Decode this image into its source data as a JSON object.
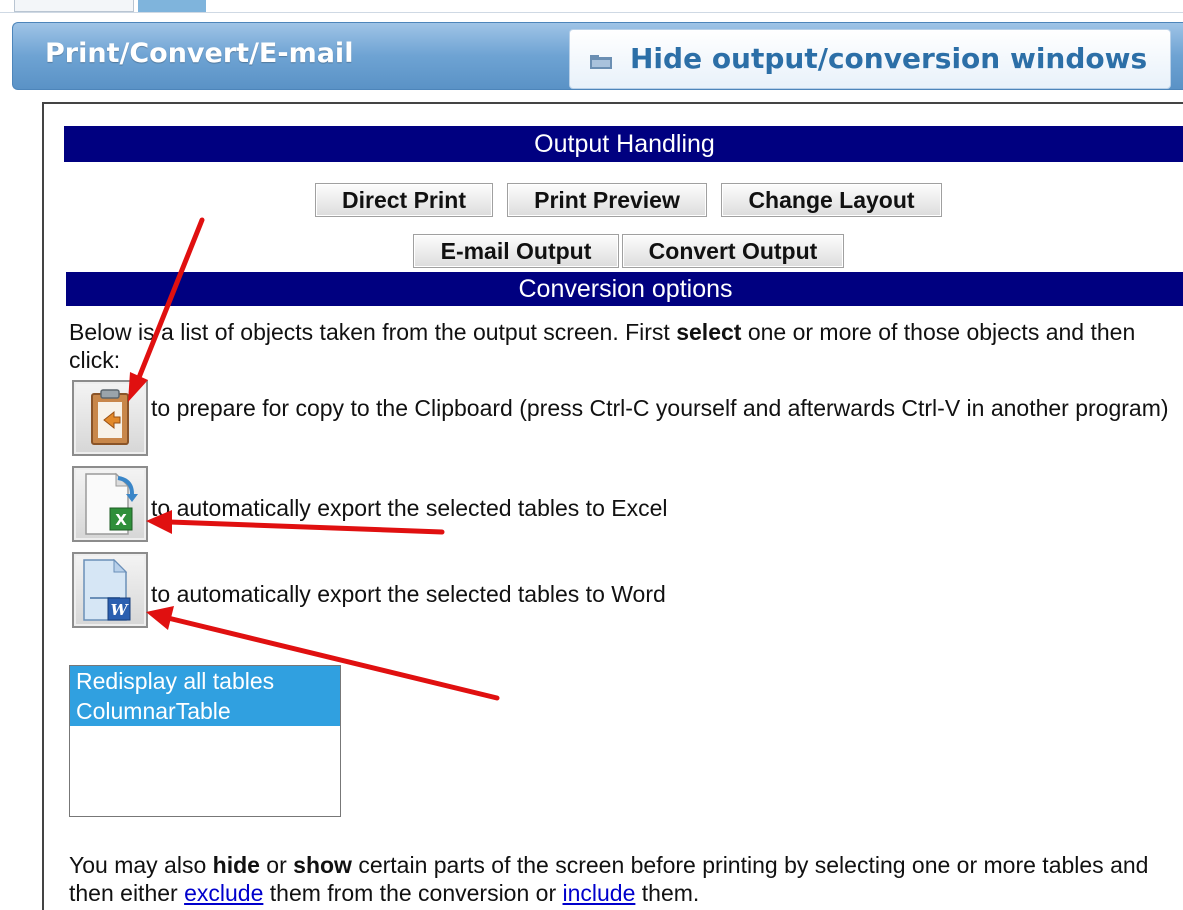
{
  "header": {
    "title": "Print/Convert/E-mail",
    "hide_button_label": "Hide output/conversion windows"
  },
  "output_handling": {
    "title": "Output Handling",
    "buttons": {
      "direct_print": "Direct Print",
      "print_preview": "Print Preview",
      "change_layout": "Change Layout",
      "email_output": "E-mail Output",
      "convert_output": "Convert Output"
    }
  },
  "conversion_options": {
    "title": "Conversion options",
    "intro_pre": "Below is a list of objects taken from the output screen. First ",
    "intro_bold": "select",
    "intro_post": " one or more of those objects and then click:",
    "clipboard_text": "to prepare for copy to the Clipboard (press Ctrl-C yourself and afterwards Ctrl-V in another program)",
    "excel_text": "to automatically export the selected tables to Excel",
    "word_text": "to automatically export the selected tables to Word",
    "list_items": [
      "Redisplay all tables",
      "ColumnarTable"
    ],
    "footer": {
      "p1": "You may also ",
      "hide": "hide",
      "p2": " or ",
      "show": "show",
      "p3": " certain parts of the screen before printing by selecting one or more tables and then either ",
      "exclude_link": "exclude",
      "p4": " them from the conversion or ",
      "include_link": "include",
      "p5": " them."
    }
  },
  "icons": {
    "folder": "folder-icon",
    "clipboard": "clipboard-icon",
    "excel": "excel-export-icon",
    "word": "word-export-icon"
  },
  "colors": {
    "header_blue": "#6ea3d3",
    "navy": "#000080",
    "selection_blue": "#30a0e0",
    "annotation_red": "#e01010"
  }
}
